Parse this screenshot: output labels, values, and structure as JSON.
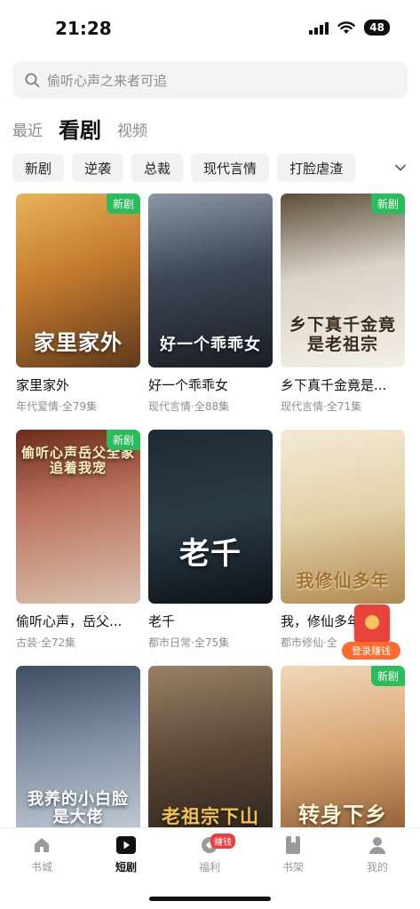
{
  "status_bar": {
    "time": "21:28",
    "battery": "48"
  },
  "search": {
    "placeholder": "偷听心声之来者可追"
  },
  "channel_tabs": [
    {
      "label": "最近",
      "active": false
    },
    {
      "label": "看剧",
      "active": true
    },
    {
      "label": "视频",
      "active": false
    }
  ],
  "genres": [
    "新剧",
    "逆袭",
    "总裁",
    "现代言情",
    "打脸虐渣"
  ],
  "badge_new": "新剧",
  "dramas": [
    {
      "title": "家里家外",
      "meta": "年代爱情·全79集",
      "poster_text": "家里家外",
      "is_new": true
    },
    {
      "title": "好一个乖乖女",
      "meta": "现代言情·全88集",
      "poster_text": "好一个乖乖女",
      "is_new": false
    },
    {
      "title": "乡下真千金竟是...",
      "meta": "现代言情·全71集",
      "poster_text": "乡下真千金竟是老祖宗",
      "is_new": true
    },
    {
      "title": "偷听心声，岳父...",
      "meta": "古装·全72集",
      "poster_text": "偷听心声岳父全家追着我宠",
      "is_new": true
    },
    {
      "title": "老千",
      "meta": "都市日常·全75集",
      "poster_text": "老千",
      "is_new": false
    },
    {
      "title": "我，修仙多年",
      "meta": "都市修仙·全",
      "poster_text": "我修仙多年",
      "is_new": false
    },
    {
      "title": "",
      "meta": "",
      "poster_text": "我养的小白脸是大佬",
      "is_new": false
    },
    {
      "title": "",
      "meta": "",
      "poster_text": "老祖宗下山",
      "is_new": false
    },
    {
      "title": "",
      "meta": "",
      "poster_text": "转身下乡",
      "is_new": true
    }
  ],
  "reward": {
    "label": "登录赚钱"
  },
  "bottom_nav": [
    {
      "label": "书城",
      "icon": "home-icon",
      "active": false
    },
    {
      "label": "短剧",
      "icon": "play-icon",
      "active": true
    },
    {
      "label": "福利",
      "icon": "gift-icon",
      "active": false,
      "badge": "赚钱"
    },
    {
      "label": "书架",
      "icon": "bookshelf-icon",
      "active": false
    },
    {
      "label": "我的",
      "icon": "profile-icon",
      "active": false
    }
  ],
  "colors": {
    "accent_green": "#2bbd5c",
    "reward_orange": "#ff6a2e",
    "badge_red": "#ef3b3b"
  }
}
